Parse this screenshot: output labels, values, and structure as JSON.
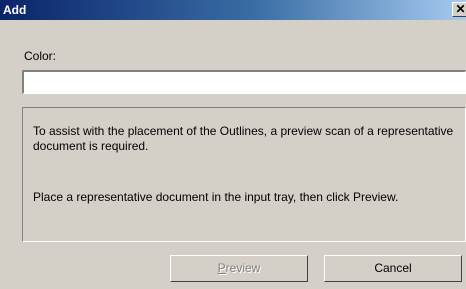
{
  "window": {
    "title": "Add",
    "close_glyph": "✕"
  },
  "form": {
    "color_label": "Color:",
    "color_value": "",
    "color_placeholder": ""
  },
  "info": {
    "line_1": "To assist with the placement of the Outlines, a preview scan of a representative document is required.",
    "line_2": "Place a representative document in the input tray, then click Preview."
  },
  "buttons": {
    "preview_label": "Preview",
    "preview_enabled": false,
    "cancel_label": "Cancel"
  },
  "colors": {
    "titlebar_start": "#0a246a",
    "titlebar_end": "#a6caf0",
    "dialog_face": "#d4d0c8",
    "disabled_text": "#808080"
  }
}
